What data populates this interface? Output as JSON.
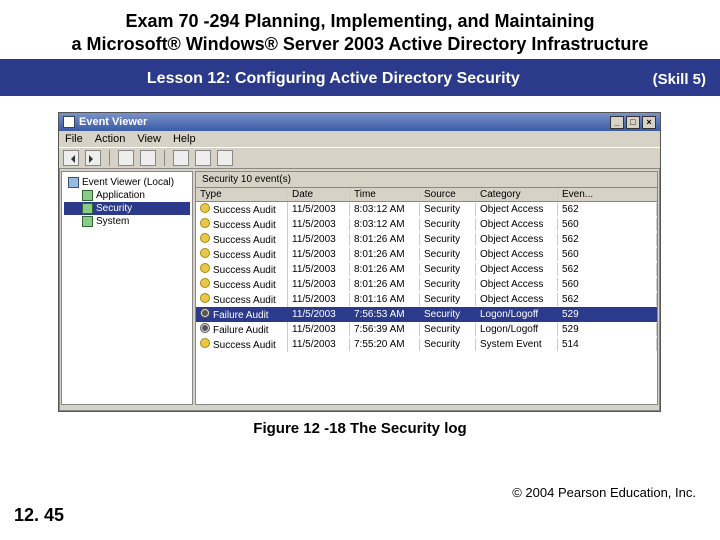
{
  "slide": {
    "exam_title_line1": "Exam 70 -294 Planning, Implementing, and Maintaining",
    "exam_title_line2": "a Microsoft® Windows® Server 2003 Active Directory Infrastructure",
    "lesson": "Lesson 12: Configuring Active Directory Security",
    "skill": "(Skill 5)",
    "figure_caption": "Figure 12 -18 The Security log",
    "page": "12. 45",
    "copyright": "© 2004 Pearson Education, Inc."
  },
  "window": {
    "title": "Event Viewer",
    "menus": [
      "File",
      "Action",
      "View",
      "Help"
    ],
    "tree_root": "Event Viewer (Local)",
    "tree_children": [
      "Application",
      "Security",
      "System"
    ],
    "selected_tree_index": 1,
    "list_caption": "Security   10 event(s)",
    "columns": [
      "Type",
      "Date",
      "Time",
      "Source",
      "Category",
      "Even..."
    ],
    "rows": [
      {
        "type": "Success Audit",
        "date": "11/5/2003",
        "time": "8:03:12 AM",
        "src": "Security",
        "cat": "Object Access",
        "evt": "562",
        "kind": "succ"
      },
      {
        "type": "Success Audit",
        "date": "11/5/2003",
        "time": "8:03:12 AM",
        "src": "Security",
        "cat": "Object Access",
        "evt": "560",
        "kind": "succ"
      },
      {
        "type": "Success Audit",
        "date": "11/5/2003",
        "time": "8:01:26 AM",
        "src": "Security",
        "cat": "Object Access",
        "evt": "562",
        "kind": "succ"
      },
      {
        "type": "Success Audit",
        "date": "11/5/2003",
        "time": "8:01:26 AM",
        "src": "Security",
        "cat": "Object Access",
        "evt": "560",
        "kind": "succ"
      },
      {
        "type": "Success Audit",
        "date": "11/5/2003",
        "time": "8:01:26 AM",
        "src": "Security",
        "cat": "Object Access",
        "evt": "562",
        "kind": "succ"
      },
      {
        "type": "Success Audit",
        "date": "11/5/2003",
        "time": "8:01:26 AM",
        "src": "Security",
        "cat": "Object Access",
        "evt": "560",
        "kind": "succ"
      },
      {
        "type": "Success Audit",
        "date": "11/5/2003",
        "time": "8:01:16 AM",
        "src": "Security",
        "cat": "Object Access",
        "evt": "562",
        "kind": "succ"
      },
      {
        "type": "Failure Audit",
        "date": "11/5/2003",
        "time": "7:56:53 AM",
        "src": "Security",
        "cat": "Logon/Logoff",
        "evt": "529",
        "kind": "fail",
        "selected": true
      },
      {
        "type": "Failure Audit",
        "date": "11/5/2003",
        "time": "7:56:39 AM",
        "src": "Security",
        "cat": "Logon/Logoff",
        "evt": "529",
        "kind": "fail"
      },
      {
        "type": "Success Audit",
        "date": "11/5/2003",
        "time": "7:55:20 AM",
        "src": "Security",
        "cat": "System Event",
        "evt": "514",
        "kind": "succ"
      }
    ]
  }
}
